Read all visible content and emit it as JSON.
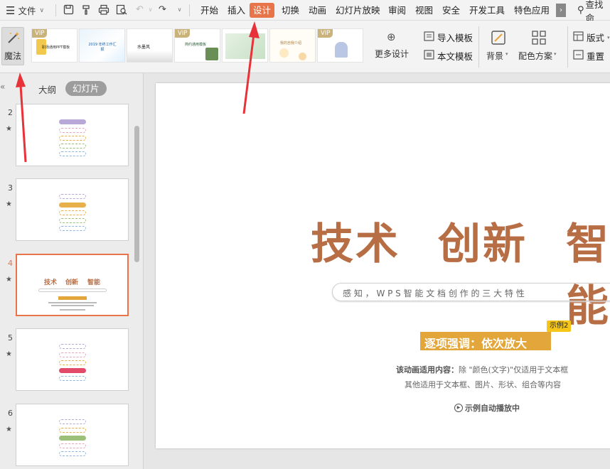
{
  "menubar": {
    "file_label": "文件",
    "tabs": [
      "开始",
      "插入",
      "设计",
      "切换",
      "动画",
      "幻灯片放映",
      "审阅",
      "视图",
      "安全",
      "开发工具",
      "特色应用"
    ],
    "active_tab": "设计",
    "search_label": "查找命"
  },
  "ribbon": {
    "magic_label": "魔法",
    "vip_label": "VIP",
    "templates": [
      {
        "caption": "职场通用PPT模板",
        "vip": true
      },
      {
        "caption": "2019 年终工作汇报",
        "vip": false
      },
      {
        "caption": "水墨风",
        "vip": false
      },
      {
        "caption": "简约通用模板",
        "vip": true
      },
      {
        "caption": "",
        "vip": false
      },
      {
        "caption": "我的自我介绍",
        "vip": true
      },
      {
        "caption": "",
        "vip": true
      }
    ],
    "more_design": "更多设计",
    "import_template": "导入模板",
    "this_template": "本文模板",
    "background": "背景",
    "color_scheme": "配色方案",
    "layout": "版式",
    "reset": "重置"
  },
  "panel": {
    "tab_outline": "大纲",
    "tab_slides": "幻灯片",
    "slides": [
      {
        "number": "2",
        "selected": false
      },
      {
        "number": "3",
        "selected": false
      },
      {
        "number": "4",
        "selected": true
      },
      {
        "number": "5",
        "selected": false
      },
      {
        "number": "6",
        "selected": false
      }
    ],
    "thumb4": {
      "title_words": [
        "技术",
        "创新",
        "智能"
      ]
    }
  },
  "slide": {
    "word1": "技术",
    "word2": "创新",
    "word3": "智能",
    "subtitle": "感 知 ， W P S 智 能 文 档 创 作 的 三 大 特 性",
    "highlight_label": "逐项强调：依次放大",
    "badge": "示例2",
    "desc_line1_label": "该动画适用内容：",
    "desc_line1_rest": "除 \"颜色(文字)\"仅适用于文本框",
    "desc_line2": "其他适用于文本框、图片、形状、组合等内容",
    "autoplay": "示例自动播放中"
  },
  "colors": {
    "accent": "#e8744a",
    "title_brown": "#b86e45",
    "highlight_bg": "#e2a63a",
    "badge_bg": "#f5c518",
    "annotation_red": "#e8323a"
  }
}
